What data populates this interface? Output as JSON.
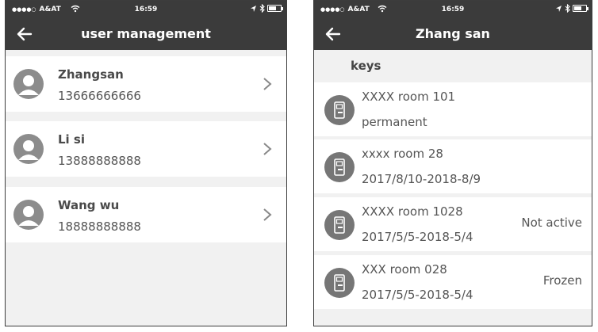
{
  "status_bar": {
    "signal_dots": "●●●●○",
    "carrier": "A&AT",
    "time": "16:59"
  },
  "left_screen": {
    "title": "user management",
    "users": [
      {
        "name": "Zhangsan",
        "phone": "13666666666"
      },
      {
        "name": "Li si",
        "phone": "13888888888"
      },
      {
        "name": "Wang wu",
        "phone": "18888888888"
      }
    ]
  },
  "right_screen": {
    "title": "Zhang san",
    "section_label": "keys",
    "keys": [
      {
        "name": "XXXX room 101",
        "validity": "permanent",
        "status": ""
      },
      {
        "name": "xxxx room 28",
        "validity": "2017/8/10-2018-8/9",
        "status": ""
      },
      {
        "name": "XXXX room 1028",
        "validity": "2017/5/5-2018-5/4",
        "status": "Not active"
      },
      {
        "name": "XXX room 028",
        "validity": "2017/5/5-2018-5/4",
        "status": "Frozen"
      }
    ]
  },
  "icons": {
    "back": "back-arrow-icon",
    "avatar": "user-avatar-icon",
    "chevron": "chevron-right-icon",
    "lock": "door-lock-icon",
    "wifi": "wifi-icon",
    "location": "location-arrow-icon",
    "bluetooth": "bluetooth-icon",
    "battery": "battery-icon"
  },
  "colors": {
    "header": "#3b3b3b",
    "background": "#f1f1f1",
    "row": "#ffffff",
    "icon": "#7a7a7a"
  }
}
